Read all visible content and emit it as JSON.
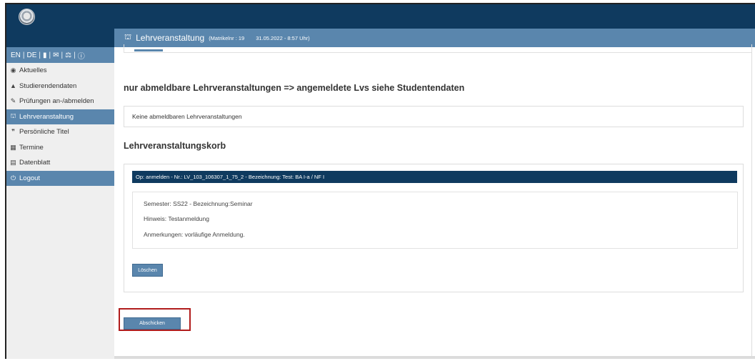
{
  "header": {
    "title": "Lehrveranstaltung",
    "matrikel": "(Matrikelnr : 19",
    "datetime": "31.05.2022 - 8:57 Uhr)"
  },
  "sidebar": {
    "lang": [
      "EN",
      "DE"
    ],
    "items": [
      {
        "label": "Aktuelles",
        "icon": "comment-icon"
      },
      {
        "label": "Studierendendaten",
        "icon": "graduation-cap-icon"
      },
      {
        "label": "Prüfungen an-/abmelden",
        "icon": "edit-icon"
      },
      {
        "label": "Lehrveranstaltung",
        "icon": "university-icon"
      },
      {
        "label": "Persönliche Titel",
        "icon": "quote-icon"
      },
      {
        "label": "Termine",
        "icon": "calendar-icon"
      },
      {
        "label": "Datenblatt",
        "icon": "list-icon"
      },
      {
        "label": "Logout",
        "icon": "power-icon"
      }
    ]
  },
  "main": {
    "heading_abmeldbar": "nur abmeldbare Lehrveranstaltungen => angemeldete Lvs siehe Studentendaten",
    "no_courses": "Keine abmeldbaren Lehrveranstaltungen",
    "heading_korb": "Lehrveranstaltungskorb",
    "korb_item": {
      "title": "Op: anmelden - Nr.: LV_103_106307_1_75_2 - Bezeichnung: Test: BA I-a / NF I",
      "semester": "Semester: SS22 - Bezeichnung:Seminar",
      "hinweis": "Hinweis: Testanmeldung",
      "anmerkungen": "Anmerkungen: vorläufige Anmeldung.",
      "delete_label": "Löschen"
    },
    "submit_label": "Abschicken"
  },
  "colors": {
    "dark_blue": "#0f3a5f",
    "accent_blue": "#5a86ad",
    "highlight_red": "#b11c1c"
  }
}
